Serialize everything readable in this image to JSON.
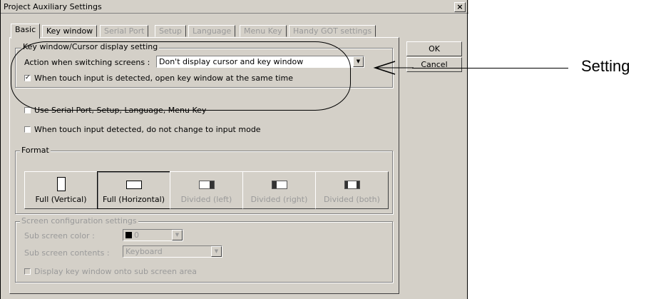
{
  "window": {
    "title": "Project Auxiliary Settings",
    "close_glyph": "×"
  },
  "tabs": [
    {
      "label": "Basic",
      "active": true,
      "enabled": true
    },
    {
      "label": "Key window",
      "active": false,
      "enabled": true
    },
    {
      "label": "Serial Port",
      "active": false,
      "enabled": false
    },
    {
      "label": "Setup",
      "active": false,
      "enabled": false
    },
    {
      "label": "Language",
      "active": false,
      "enabled": false
    },
    {
      "label": "Menu Key",
      "active": false,
      "enabled": false
    },
    {
      "label": "Handy GOT settings",
      "active": false,
      "enabled": false
    }
  ],
  "buttons": {
    "ok": "OK",
    "cancel": "Cancel"
  },
  "key_window_group": {
    "legend": "Key window/Cursor display setting",
    "action_label": "Action when switching screens :",
    "action_value": "Don't display cursor and key window",
    "touch_checkbox_label": "When touch input is detected, open key window at the same time",
    "touch_checked": true
  },
  "options": {
    "serial_label": "Use Serial Port, Setup, Language, Menu Key",
    "serial_checked": false,
    "input_mode_label": "When touch input detected, do not change to input mode",
    "input_mode_checked": false
  },
  "format_group": {
    "legend": "Format",
    "options": [
      {
        "label": "Full (Vertical)",
        "enabled": true,
        "selected": false,
        "icon": "full-vertical-icon"
      },
      {
        "label": "Full (Horizontal)",
        "enabled": true,
        "selected": true,
        "icon": "full-horizontal-icon"
      },
      {
        "label": "Divided (left)",
        "enabled": false,
        "selected": false,
        "icon": "divided-left-icon"
      },
      {
        "label": "Divided (right)",
        "enabled": false,
        "selected": false,
        "icon": "divided-right-icon"
      },
      {
        "label": "Divided (both)",
        "enabled": false,
        "selected": false,
        "icon": "divided-both-icon"
      }
    ]
  },
  "screen_config": {
    "legend": "Screen configuration settings",
    "sub_color_label": "Sub screen color :",
    "sub_color_value": "0",
    "sub_contents_label": "Sub screen contents :",
    "sub_contents_value": "Keyboard",
    "display_key_label": "Display key window onto sub screen area",
    "display_key_checked": false
  },
  "annotation": {
    "text": "Setting"
  },
  "check_glyph": "✓",
  "arrow_glyph": "▼",
  "colors": {
    "dialog_bg": "#d4d0c8",
    "disabled_text": "#9a9a9a"
  }
}
